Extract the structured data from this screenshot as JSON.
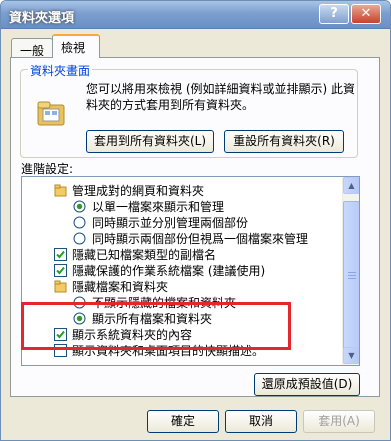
{
  "window": {
    "title": "資料夾選項",
    "help_label": "?",
    "close_label": "✕"
  },
  "tabs": [
    {
      "label": "一般"
    },
    {
      "label": "檢視"
    }
  ],
  "folder_views": {
    "label": "資料夾畫面",
    "description": "您可以將用來檢視 (例如詳細資料或並排顯示) 此資料夾的方式套用到所有資料夾。",
    "apply_all_label": "套用到所有資料夾(L)",
    "reset_all_label": "重設所有資料夾(R)"
  },
  "advanced": {
    "label": "進階設定:",
    "items": [
      {
        "type": "folder",
        "text": "管理成對的網頁和資料夾"
      },
      {
        "type": "radio",
        "checked": true,
        "text": "以單一檔案來顯示和管理"
      },
      {
        "type": "radio",
        "checked": false,
        "text": "同時顯示並分別管理兩個部份"
      },
      {
        "type": "radio",
        "checked": false,
        "text": "同時顯示兩個部份但視爲一個檔案來管理"
      },
      {
        "type": "checkbox",
        "checked": true,
        "text": "隱藏已知檔案類型的副檔名"
      },
      {
        "type": "checkbox",
        "checked": true,
        "text": "隱藏保護的作業系統檔案 (建議使用)"
      },
      {
        "type": "folder",
        "text": "隱藏檔案和資料夾"
      },
      {
        "type": "radio",
        "checked": false,
        "text": "不顯示隱藏的檔案和資料夾"
      },
      {
        "type": "radio",
        "checked": true,
        "text": "顯示所有檔案和資料夾"
      },
      {
        "type": "checkbox",
        "checked": true,
        "text": "顯示系統資料夾的內容"
      },
      {
        "type": "checkbox",
        "checked": false,
        "text": "顯示資料夾和桌面項目的快顯描述。"
      }
    ],
    "restore_label": "還原成預設值(D)"
  },
  "footer": {
    "ok_label": "確定",
    "cancel_label": "取消",
    "apply_label": "套用(A)"
  },
  "colors": {
    "highlight": "#e4262d",
    "accent": "#f6a93c"
  }
}
